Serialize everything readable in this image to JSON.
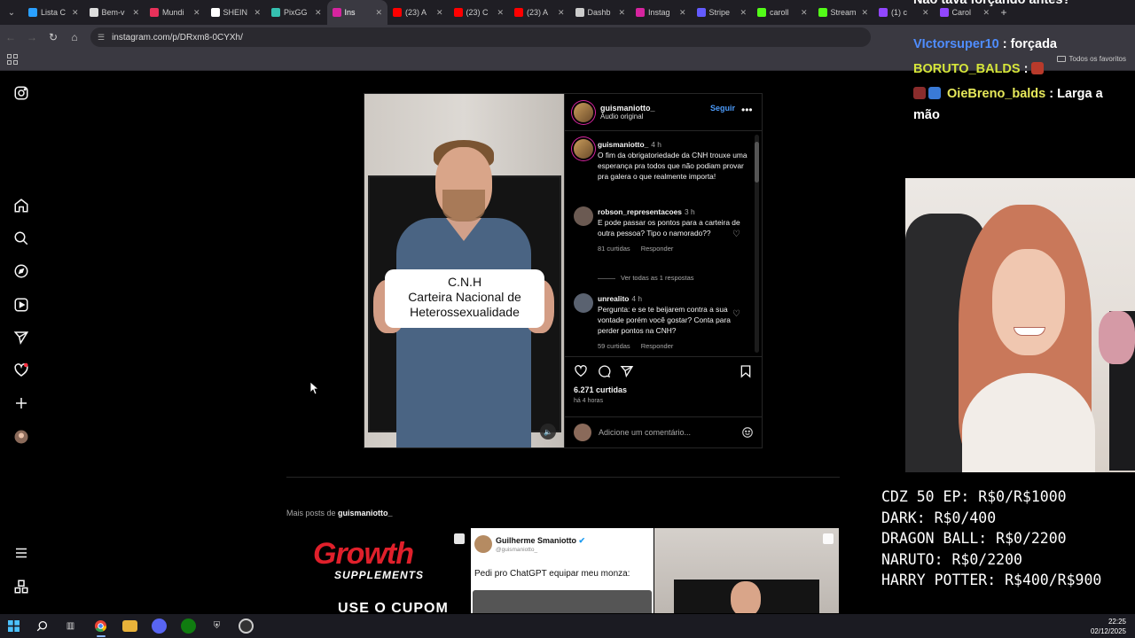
{
  "browser": {
    "tabs": [
      {
        "label": "Lista C",
        "color": "#2aa0ff",
        "active": false
      },
      {
        "label": "Bem-v",
        "color": "#dddddd",
        "active": false
      },
      {
        "label": "Mundi",
        "color": "#e8315a",
        "active": false
      },
      {
        "label": "SHEIN",
        "color": "#ffffff",
        "active": false
      },
      {
        "label": "PixGG",
        "color": "#35c0b0",
        "active": false
      },
      {
        "label": "Ins",
        "color": "#d6249f",
        "active": true
      },
      {
        "label": "(23) A",
        "color": "#ff0000",
        "active": false
      },
      {
        "label": "(23) C",
        "color": "#ff0000",
        "active": false
      },
      {
        "label": "(23) A",
        "color": "#ff0000",
        "active": false
      },
      {
        "label": "Dashb",
        "color": "#cccccc",
        "active": false
      },
      {
        "label": "Instag",
        "color": "#d6249f",
        "active": false
      },
      {
        "label": "Stripe",
        "color": "#635bff",
        "active": false
      },
      {
        "label": "caroll",
        "color": "#53fc18",
        "active": false
      },
      {
        "label": "Stream",
        "color": "#53fc18",
        "active": false
      },
      {
        "label": "(1) c",
        "color": "#9146ff",
        "active": false
      },
      {
        "label": "Carol",
        "color": "#9146ff",
        "active": false
      }
    ],
    "url": "instagram.com/p/DRxm8-0CYXh/",
    "bookmarks_all": "Todos os favoritos"
  },
  "post": {
    "author": "guismaniotto_",
    "audio": "Áudio original",
    "follow": "Seguir",
    "more": "•••",
    "video_caption": [
      "C.N.H",
      "Carteira Nacional de",
      "Heterossexualidade"
    ],
    "comments": [
      {
        "user": "guismaniotto_",
        "time": "4 h",
        "text": "O fim da obrigatoriedade da CNH trouxe uma esperança pra todos que não podiam provar pra galera  o que realmente importa!",
        "likes": "",
        "reply": "",
        "liked_icon": false
      },
      {
        "user": "robson_representacoes",
        "time": "3 h",
        "text": "E pode passar os pontos para a carteira de outra pessoa? Tipo o namorado??",
        "likes": "81 curtidas",
        "reply": "Responder",
        "liked_icon": true
      },
      {
        "user": "unrealito",
        "time": "4 h",
        "text": "Pergunta: e se te beijarem contra a sua vontade porém você gostar? Conta para perder pontos na CNH?",
        "likes": "59 curtidas",
        "reply": "Responder",
        "liked_icon": true
      }
    ],
    "view_replies": "Ver todas as 1 respostas",
    "likes": "6.271 curtidas",
    "posted": "há 4 horas",
    "comment_placeholder": "Adicione um comentário..."
  },
  "more_posts": {
    "label": "Mais posts de",
    "user": "guismaniotto_",
    "thumb1": {
      "brand": "Growth",
      "sub": "SUPPLEMENTS",
      "cta": "USE O CUPOM"
    },
    "thumb2": {
      "name": "Guilherme Smaniotto",
      "handle": "@guismaniotto_",
      "text": "Pedi pro ChatGPT equipar meu monza:"
    }
  },
  "overlay": {
    "chat": [
      {
        "user": "",
        "text": "Não tava forçando antes?",
        "user_color": "#ffffff"
      },
      {
        "user": "VIctorsuper10",
        "text": ": forçada",
        "user_color": "#4f8dff"
      },
      {
        "user": "BORUTO_BALDS",
        "text": ":",
        "user_color": "#d6e63a"
      },
      {
        "user": "OieBreno_balds",
        "text": ": Larga a mão",
        "user_color": "#e6e85a"
      }
    ],
    "goals": [
      "CDZ 50 EP: R$0/R$1000",
      "DARK: R$0/400",
      "DRAGON BALL: R$0/2200",
      "NARUTO: R$0/2200",
      "HARRY POTTER: R$400/R$900"
    ]
  },
  "taskbar": {
    "time": "22:25",
    "date": "02/12/2025"
  },
  "colors": {
    "accent_blue": "#4c9bfa",
    "ig_bg": "#000000",
    "notification": "#ff3040"
  }
}
